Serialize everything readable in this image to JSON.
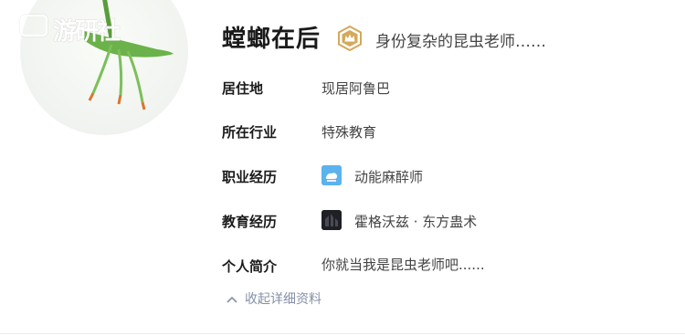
{
  "profile": {
    "name": "螳螂在后",
    "headline": "身份复杂的昆虫老师……",
    "badge_icon": "crown-badge-icon",
    "avatar_icon": "mantis-avatar-icon"
  },
  "watermark": {
    "text": "游研社",
    "icon": "gamepad-icon"
  },
  "details": [
    {
      "label": "居住地",
      "value": "现居阿鲁巴"
    },
    {
      "label": "所在行业",
      "value": "特殊教育"
    },
    {
      "label": "职业经历",
      "value": "动能麻醉师",
      "icon": "company-logo-icon"
    },
    {
      "label": "教育经历",
      "value": "霍格沃兹 · 东方蛊术",
      "icon": "school-logo-icon"
    },
    {
      "label": "个人简介",
      "value": "你就当我是昆虫老师吧......"
    }
  ],
  "collapse": {
    "label": "收起详细资料",
    "icon": "chevron-up-icon"
  },
  "colors": {
    "badge": "#d4a95a",
    "link": "#8590a6"
  }
}
